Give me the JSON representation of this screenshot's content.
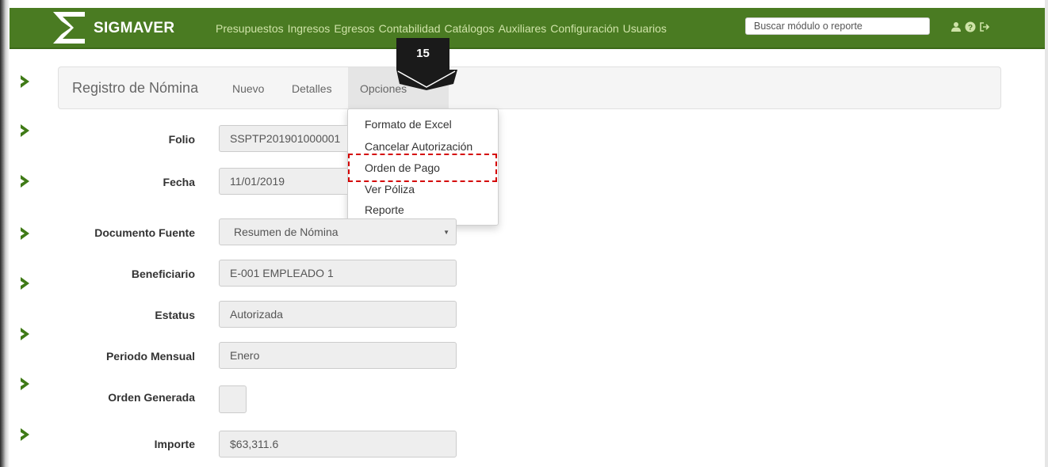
{
  "app": {
    "brand": "SIGMAVER"
  },
  "nav": {
    "links": [
      "Presupuestos",
      "Ingresos",
      "Egresos",
      "Contabilidad",
      "Catálogos",
      "Auxiliares",
      "Configuración",
      "Usuarios"
    ],
    "search_placeholder": "Buscar módulo o reporte",
    "icons": [
      "user-icon",
      "help-icon",
      "logout-icon"
    ]
  },
  "subheader": {
    "title": "Registro de Nómina",
    "links": [
      "Nuevo",
      "Detalles",
      "Opciones"
    ]
  },
  "marker": {
    "label": "15"
  },
  "dropdown": {
    "items": [
      "Formato de Excel",
      "Cancelar Autorización",
      "Orden de Pago",
      "Ver Póliza",
      "Reporte"
    ],
    "highlighted": "Orden de Pago"
  },
  "form": {
    "folio": {
      "label": "Folio",
      "value": "SSPTP201901000001"
    },
    "fecha": {
      "label": "Fecha",
      "value": "11/01/2019"
    },
    "documento_fuente": {
      "label": "Documento Fuente",
      "value": "Resumen de Nómina"
    },
    "beneficiario": {
      "label": "Beneficiario",
      "value": "E-001 EMPLEADO 1"
    },
    "estatus": {
      "label": "Estatus",
      "value": "Autorizada"
    },
    "periodo_mensual": {
      "label": "Periodo Mensual",
      "value": "Enero"
    },
    "orden_generada": {
      "label": "Orden Generada",
      "checked": false
    },
    "importe": {
      "label": "Importe",
      "value": "$63,311.6"
    }
  },
  "colors": {
    "navbar": "#4a7b22",
    "nav_link": "#cfe3a8",
    "chevron": "#3f7a16",
    "highlight": "#d40000"
  }
}
